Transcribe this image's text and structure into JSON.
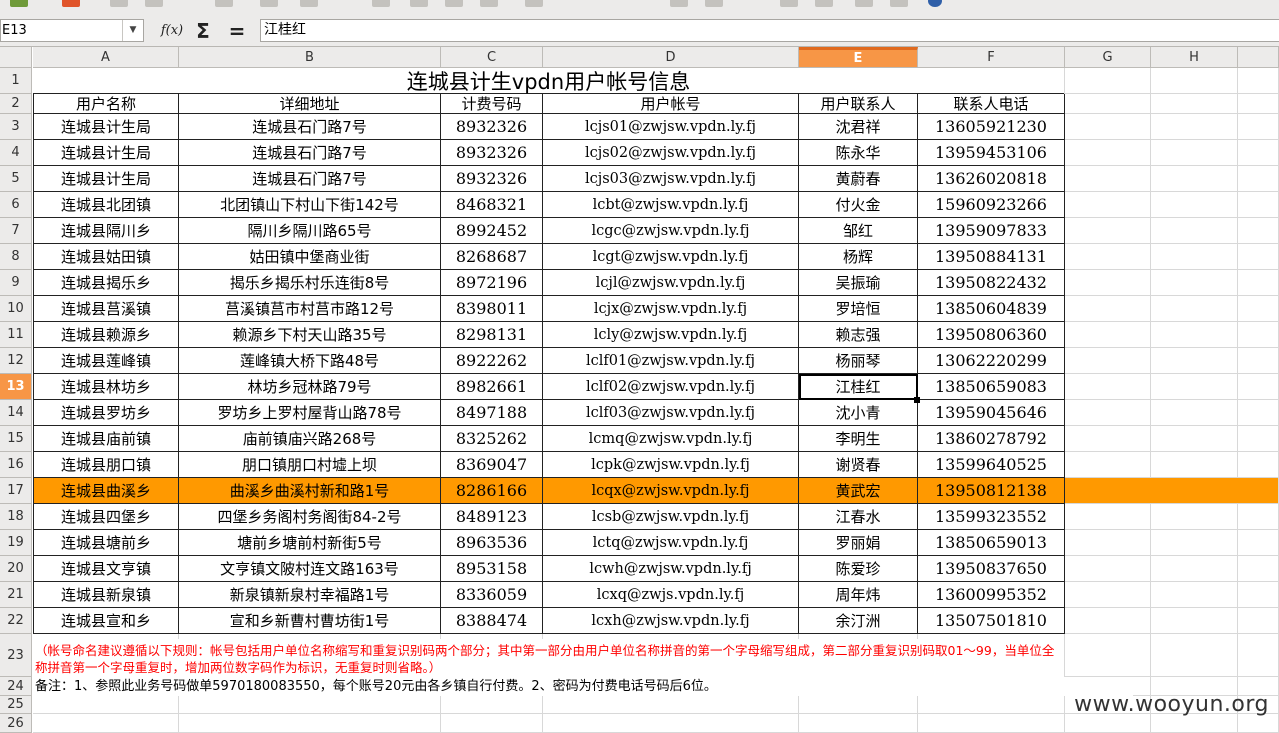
{
  "namebox": {
    "value": "E13",
    "dropdown": "▼"
  },
  "formula": {
    "fx_label": "f(x)",
    "sum_label": "Σ",
    "equals_label": "=",
    "content": "江桂红"
  },
  "columns": [
    "A",
    "B",
    "C",
    "D",
    "E",
    "F",
    "G",
    "H"
  ],
  "selected_column": "E",
  "selected_row": "13",
  "row_numbers": [
    "1",
    "2",
    "3",
    "4",
    "5",
    "6",
    "7",
    "8",
    "9",
    "10",
    "11",
    "12",
    "13",
    "14",
    "15",
    "16",
    "17",
    "18",
    "19",
    "20",
    "21",
    "22",
    "23",
    "24",
    "25",
    "26"
  ],
  "title": "连城县计生vpdn用户帐号信息",
  "headers": [
    "用户名称",
    "详细地址",
    "计费号码",
    "用户帐号",
    "用户联系人",
    "联系人电话"
  ],
  "rows": [
    [
      "连城县计生局",
      "连城县石门路7号",
      "8932326",
      "lcjs01@zwjsw.vpdn.ly.fj",
      "沈君祥",
      "13605921230"
    ],
    [
      "连城县计生局",
      "连城县石门路7号",
      "8932326",
      "lcjs02@zwjsw.vpdn.ly.fj",
      "陈永华",
      "13959453106"
    ],
    [
      "连城县计生局",
      "连城县石门路7号",
      "8932326",
      "lcjs03@zwjsw.vpdn.ly.fj",
      "黄蔚春",
      "13626020818"
    ],
    [
      "连城县北团镇",
      "北团镇山下村山下街142号",
      "8468321",
      "lcbt@zwjsw.vpdn.ly.fj",
      "付火金",
      "15960923266"
    ],
    [
      "连城县隔川乡",
      "隔川乡隔川路65号",
      "8992452",
      "lcgc@zwjsw.vpdn.ly.fj",
      "邹红",
      "13959097833"
    ],
    [
      "连城县姑田镇",
      "姑田镇中堡商业街",
      "8268687",
      "lcgt@zwjsw.vpdn.ly.fj",
      "杨辉",
      "13950884131"
    ],
    [
      "连城县揭乐乡",
      "揭乐乡揭乐村乐连街8号",
      "8972196",
      "lcjl@zwjsw.vpdn.ly.fj",
      "吴振瑜",
      "13950822432"
    ],
    [
      "连城县莒溪镇",
      "莒溪镇莒市村莒市路12号",
      "8398011",
      "lcjx@zwjsw.vpdn.ly.fj",
      "罗培恒",
      "13850604839"
    ],
    [
      "连城县赖源乡",
      "赖源乡下村天山路35号",
      "8298131",
      "lcly@zwjsw.vpdn.ly.fj",
      "赖志强",
      "13950806360"
    ],
    [
      "连城县莲峰镇",
      "莲峰镇大桥下路48号",
      "8922262",
      "lclf01@zwjsw.vpdn.ly.fj",
      "杨丽琴",
      "13062220299"
    ],
    [
      "连城县林坊乡",
      "林坊乡冠林路79号",
      "8982661",
      "lclf02@zwjsw.vpdn.ly.fj",
      "江桂红",
      "13850659083"
    ],
    [
      "连城县罗坊乡",
      "罗坊乡上罗村屋背山路78号",
      "8497188",
      "lclf03@zwjsw.vpdn.ly.fj",
      "沈小青",
      "13959045646"
    ],
    [
      "连城县庙前镇",
      "庙前镇庙兴路268号",
      "8325262",
      "lcmq@zwjsw.vpdn.ly.fj",
      "李明生",
      "13860278792"
    ],
    [
      "连城县朋口镇",
      "朋口镇朋口村墟上坝",
      "8369047",
      "lcpk@zwjsw.vpdn.ly.fj",
      "谢贤春",
      "13599640525"
    ],
    [
      "连城县曲溪乡",
      "曲溪乡曲溪村新和路1号",
      "8286166",
      "lcqx@zwjsw.vpdn.ly.fj",
      "黄武宏",
      "13950812138"
    ],
    [
      "连城县四堡乡",
      "四堡乡务阁村务阁街84-2号",
      "8489123",
      "lcsb@zwjsw.vpdn.ly.fj",
      "江春水",
      "13599323552"
    ],
    [
      "连城县塘前乡",
      "塘前乡塘前村新街5号",
      "8963536",
      "lctq@zwjsw.vpdn.ly.fj",
      "罗丽娟",
      "13850659013"
    ],
    [
      "连城县文亨镇",
      "文亨镇文陂村连文路163号",
      "8953158",
      "lcwh@zwjsw.vpdn.ly.fj",
      "陈爱珍",
      "13950837650"
    ],
    [
      "连城县新泉镇",
      "新泉镇新泉村幸福路1号",
      "8336059",
      "lcxq@zwjs.vpdn.ly.fj",
      "周年炜",
      "13600995352"
    ],
    [
      "连城县宣和乡",
      "宣和乡新曹村曹坊街1号",
      "8388474",
      "lcxh@zwjsw.vpdn.ly.fj",
      "余汀洲",
      "13507501810"
    ]
  ],
  "note_red": "（帐号命名建议遵循以下规则：帐号包括用户单位名称缩写和重复识别码两个部分；其中第一部分由用户单位名称拼音的第一个字母缩写组成，第二部分重复识别码取01～99，当单位全称拼音第一个字母重复时，增加两位数字码作为标识，无重复时则省略。）",
  "note_black": "备注：1、参照此业务号码做单5970180083550，每个账号20元由各乡镇自行付费。2、密码为付费电话号码后6位。",
  "watermark": "www.wooyun.org",
  "colors": {
    "highlight_row": "#ff9900",
    "selected_header": "#f79646",
    "note_red": "#ff0000"
  }
}
